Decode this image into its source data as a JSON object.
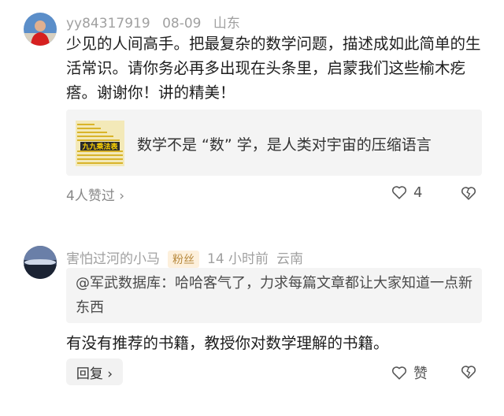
{
  "comments": [
    {
      "username": "yy84317919",
      "date": "08-09",
      "location": "山东",
      "text": "少见的人间高手。把最复杂的数学问题，描述成如此简单的生活常识。请你务必再多出现在头条里，启蒙我们这些榆木疙瘩。谢谢你！讲的精美！",
      "link_card": {
        "thumb_text": "九九乘法表",
        "title": "数学不是 “数” 学，是人类对宇宙的压缩语言"
      },
      "likes_link": "4人赞过 ›",
      "like_count": "4"
    },
    {
      "username": "害怕过河的小马",
      "badge": "粉丝",
      "time": "14 小时前",
      "location": "云南",
      "quote": "@军武数据库：哈哈客气了，力求每篇文章都让大家知道一点新东西",
      "text": "有没有推荐的书籍，教授你对数学理解的书籍。",
      "reply_label": "回复 ›",
      "like_label": "赞"
    }
  ],
  "icons": {
    "like": "heart-outline-icon",
    "dislike": "broken-heart-icon",
    "chevron": "chevron-right-icon"
  },
  "colors": {
    "badge_bg": "#fdf0dc",
    "badge_text": "#b88a3e",
    "meta": "#a0a0a0"
  }
}
